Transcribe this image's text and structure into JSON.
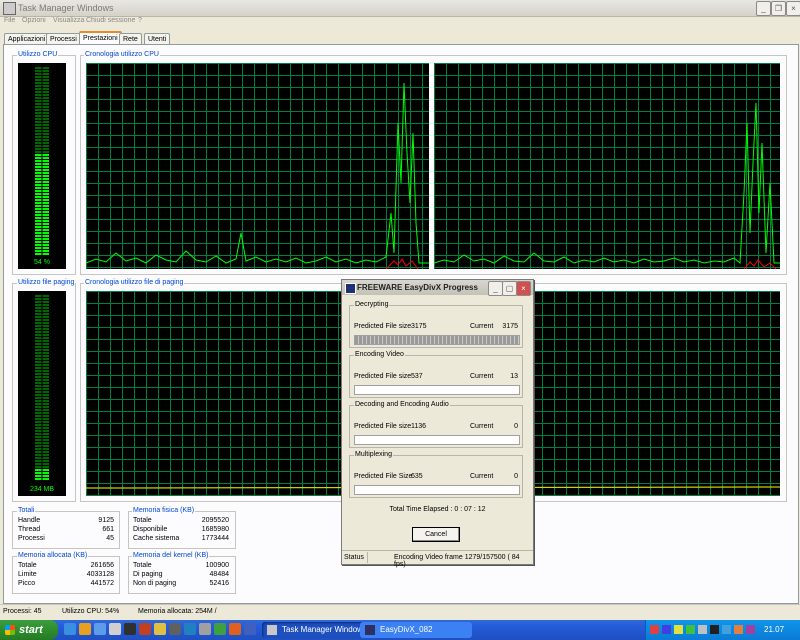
{
  "window": {
    "title": "Task Manager Windows",
    "menu": [
      "File",
      "Opzioni",
      "Visualizza",
      "Chiudi sessione",
      "?"
    ],
    "tabs": [
      "Applicazioni",
      "Processi",
      "Prestazioni",
      "Rete",
      "Utenti"
    ],
    "active_tab": "Prestazioni"
  },
  "performance": {
    "cpu_usage_label": "Utilizzo CPU",
    "cpu_usage_value": "54 %",
    "cpu_usage_percent": 54,
    "cpu_history_label": "Cronologia utilizzo CPU",
    "pagefile_label": "Utilizzo file paging",
    "pagefile_value": "234 MB",
    "pagefile_history_label": "Cronologia utilizzo file di paging"
  },
  "totals": {
    "title": "Totali",
    "rows": [
      {
        "label": "Handle",
        "value": "9125"
      },
      {
        "label": "Thread",
        "value": "661"
      },
      {
        "label": "Processi",
        "value": "45"
      }
    ]
  },
  "physical_memory": {
    "title": "Memoria fisica (KB)",
    "rows": [
      {
        "label": "Totale",
        "value": "2095520"
      },
      {
        "label": "Disponibile",
        "value": "1685980"
      },
      {
        "label": "Cache sistema",
        "value": "1773444"
      }
    ]
  },
  "commit_charge": {
    "title": "Memoria allocata (KB)",
    "rows": [
      {
        "label": "Totale",
        "value": "261656"
      },
      {
        "label": "Limite",
        "value": "4033128"
      },
      {
        "label": "Picco",
        "value": "441572"
      }
    ]
  },
  "kernel_memory": {
    "title": "Memoria del kernel (KB)",
    "rows": [
      {
        "label": "Totale",
        "value": "100900"
      },
      {
        "label": "Di paging",
        "value": "48484"
      },
      {
        "label": "Non di paging",
        "value": "52416"
      }
    ]
  },
  "statusbar": {
    "processes": "Processi: 45",
    "cpu": "Utilizzo CPU: 54%",
    "memory": "Memoria allocata: 254M /"
  },
  "taskbar": {
    "start_label": "start",
    "tasks": [
      "Task Manager Windows",
      "EasyDivX_082"
    ],
    "clock": "21.07"
  },
  "dialog": {
    "title": "FREEWARE   EasyDivX Progress",
    "sections": [
      {
        "name": "Decrypting",
        "label": "Predicted File size",
        "predicted": "3175",
        "current_label": "Current",
        "current": "3175",
        "progress": 1.0
      },
      {
        "name": "Encoding Video",
        "label": "Predicted File size",
        "predicted": "537",
        "current_label": "Current",
        "current": "13",
        "progress": 0.0
      },
      {
        "name": "Decoding and Encoding Audio",
        "label": "Predicted File size",
        "predicted": "1136",
        "current_label": "Current",
        "current": "0",
        "progress": 0.0
      },
      {
        "name": "Multiplexing",
        "label": "Predicted File Size",
        "predicted": "635",
        "current_label": "Current",
        "current": "0",
        "progress": 0.0
      }
    ],
    "elapsed_label": "Total Time Elapsed :",
    "elapsed_value": "0 : 07 : 12",
    "cancel_label": "Cancel",
    "status_label": "Status",
    "status_value": "Encoding Video frame  1279/157500  ( 84 fps)"
  },
  "colors": {
    "graph_grid": "#008040",
    "graph_line": "#00FF00",
    "kernel_line": "#FF0000",
    "taskbar": "#245DDB",
    "start": "#2D8D2D"
  }
}
